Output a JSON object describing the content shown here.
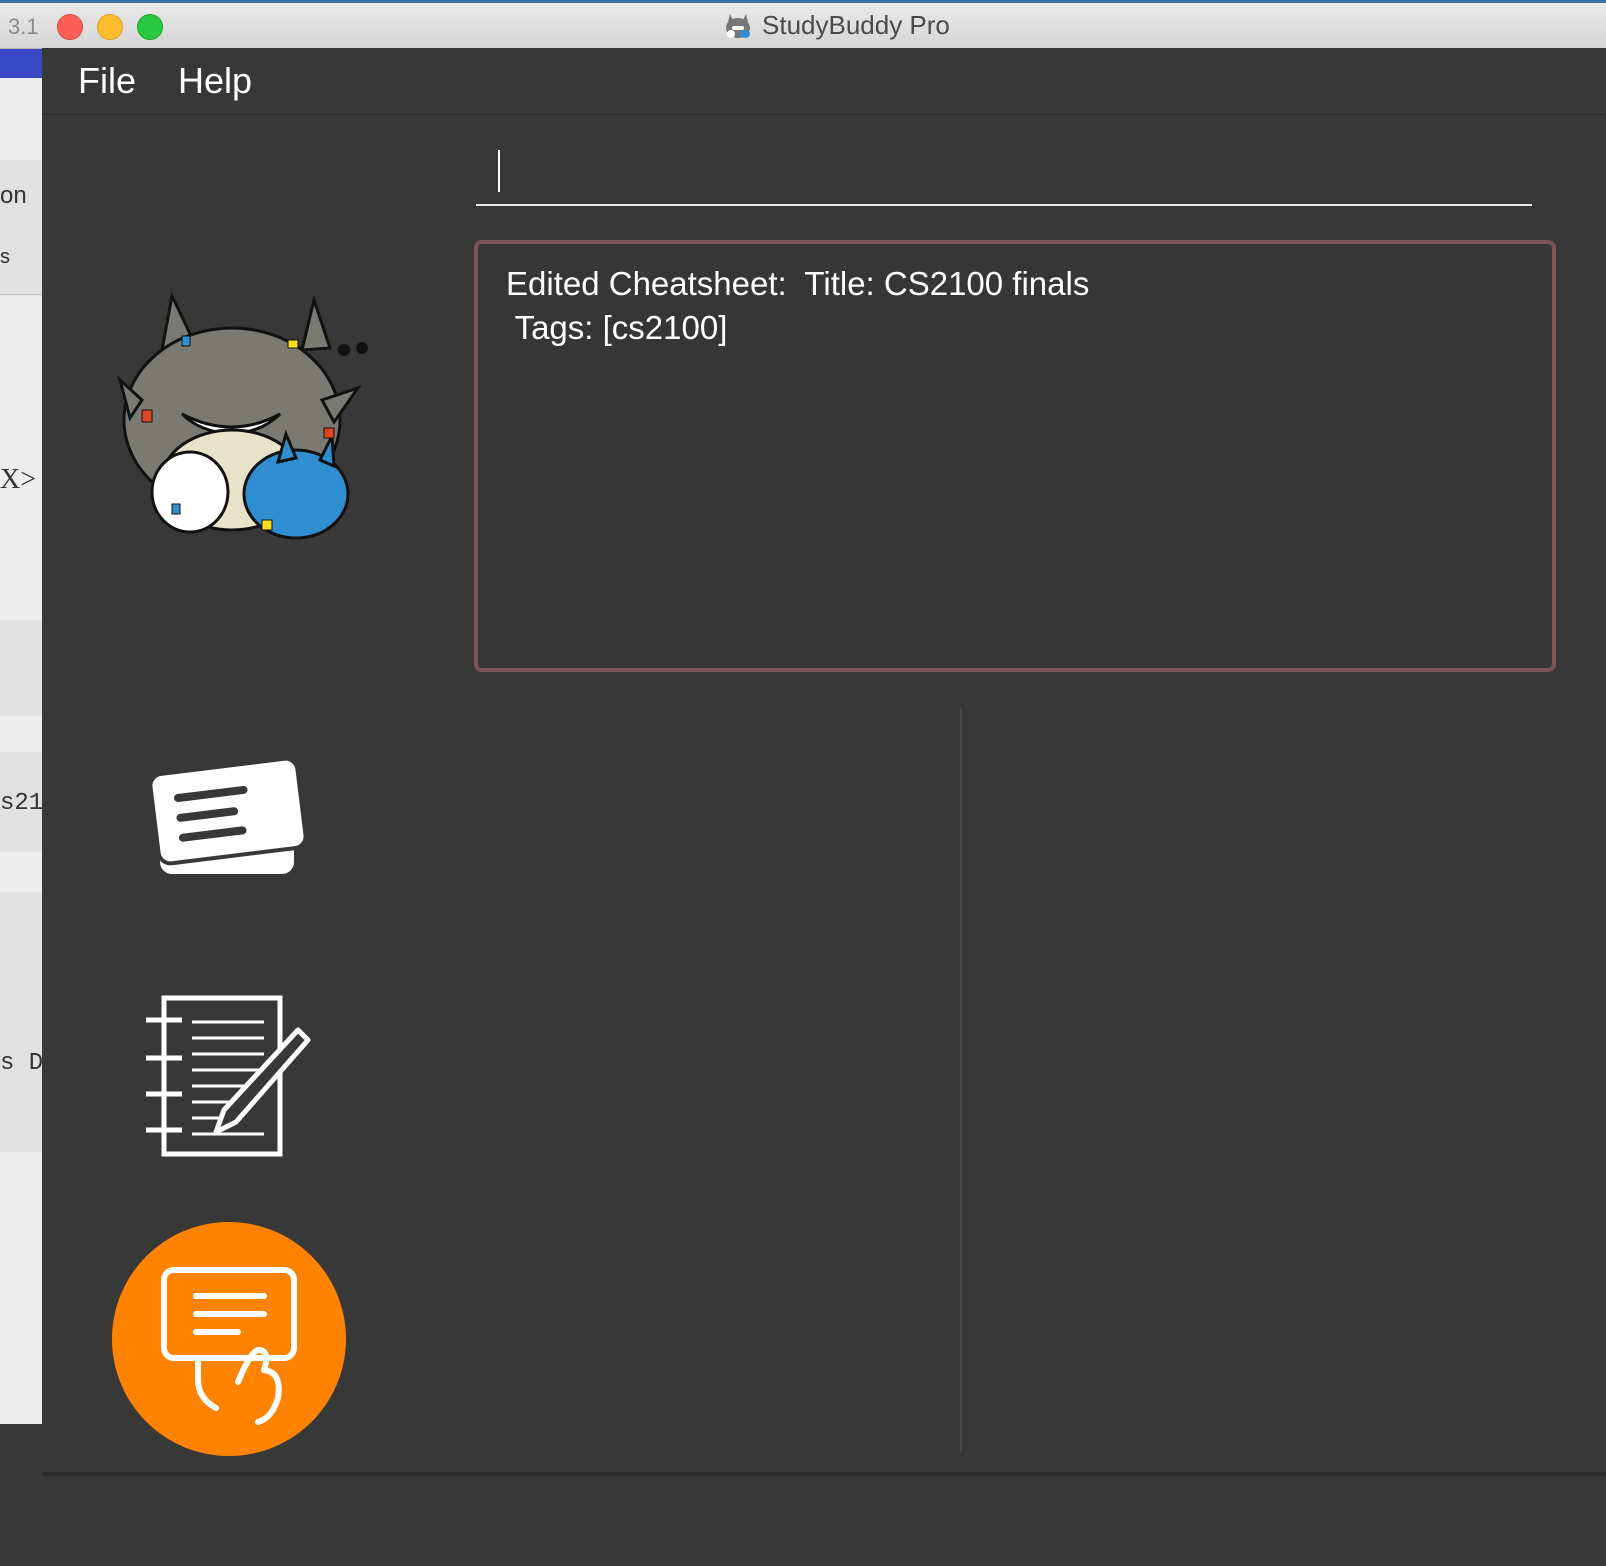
{
  "background_window": {
    "fragments": [
      "on",
      "s",
      "X>",
      "s21",
      "s D"
    ]
  },
  "window": {
    "title": "StudyBuddy Pro",
    "version_fragment": "3.1",
    "app_icon": "totoro-app-icon"
  },
  "menu": {
    "items": [
      {
        "label": "File"
      },
      {
        "label": "Help"
      }
    ]
  },
  "command_box": {
    "value": "",
    "placeholder": ""
  },
  "result_display": {
    "text": "Edited Cheatsheet:  Title: CS2100 finals\n Tags: [cs2100]"
  },
  "sidebar": {
    "items": [
      {
        "name": "mascot",
        "icon": "totoro-mascot-icon"
      },
      {
        "name": "flashcards",
        "icon": "flashcard-icon"
      },
      {
        "name": "notes",
        "icon": "notebook-pencil-icon"
      },
      {
        "name": "cheatsheets",
        "icon": "cheatsheet-hand-icon",
        "selected": true
      }
    ]
  },
  "colors": {
    "background": "#383838",
    "accent": "#ff8200",
    "result_border": "#7c5656",
    "text": "#ffffff"
  }
}
